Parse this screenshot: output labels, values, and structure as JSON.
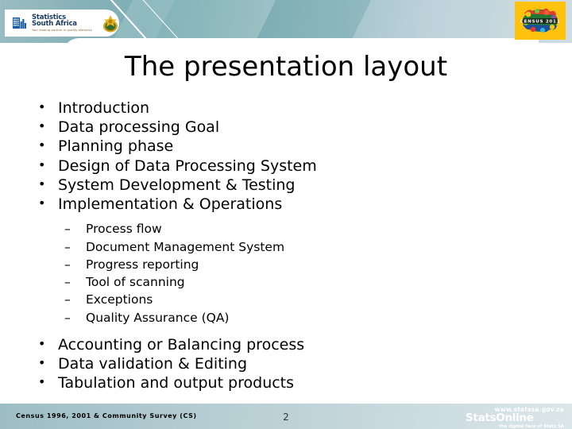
{
  "slide": {
    "title": "The presentation layout",
    "page_number": "2"
  },
  "brand": {
    "logo_line1": "Statistics",
    "logo_line2": "South Africa",
    "logo_tagline": "Your leading partner in quality statistics",
    "census_badge": "CENSUS 2011",
    "coat_of_arms": "south-african-coat-of-arms"
  },
  "outline": {
    "level1_top": [
      {
        "label": "Introduction"
      },
      {
        "label": "Data processing Goal"
      },
      {
        "label": "Planning phase"
      },
      {
        "label": "Design of Data Processing System"
      },
      {
        "label": "System Development & Testing"
      },
      {
        "label": "Implementation & Operations"
      }
    ],
    "level2": [
      {
        "label": "Process flow"
      },
      {
        "label": "Document Management System"
      },
      {
        "label": "Progress reporting"
      },
      {
        "label": "Tool of scanning"
      },
      {
        "label": "Exceptions"
      },
      {
        "label": "Quality Assurance (QA)"
      }
    ],
    "level1_bottom": [
      {
        "label": "Accounting or Balancing process"
      },
      {
        "label": "Data validation & Editing"
      },
      {
        "label": "Tabulation and output products"
      }
    ]
  },
  "footer": {
    "left_text": "Census 1996, 2001 & Community Survey (CS)",
    "statsonline_url": "www.statssa.gov.za",
    "statsonline_name": "StatsOnline",
    "statsonline_tagline": "the digital face of Stats SA"
  },
  "colors": {
    "banner_teal": "#6ea6ad",
    "banner_light": "#cfdde3",
    "census_yellow": "#ffc20e",
    "logo_navy": "#1a3a5c",
    "footer_gradient_start": "#9dbdc4",
    "footer_gradient_end": "#dbe6e9",
    "text": "#000000"
  }
}
